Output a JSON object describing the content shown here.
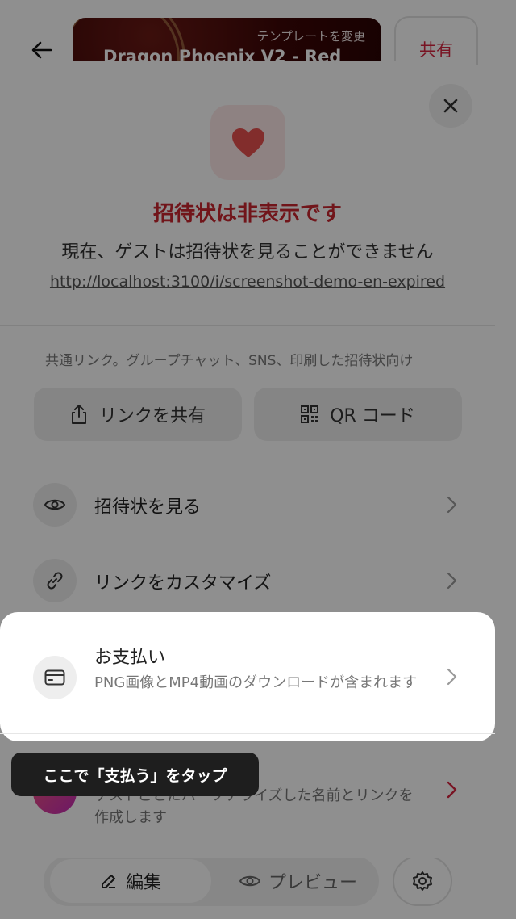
{
  "header": {
    "template_change_label": "テンプレートを変更",
    "template_name": "Dragon Phoenix V2 - Red",
    "share_label": "共有"
  },
  "modal": {
    "status_title": "招待状は非表示です",
    "status_subtitle": "現在、ゲストは招待状を見ることができません",
    "invitation_url": "http://localhost:3100/i/screenshot-demo-en-expired",
    "share_caption": "共通リンク。グループチャット、SNS、印刷した招待状向け",
    "share_link_label": "リンクを共有",
    "qr_code_label": "QR コード",
    "items": [
      {
        "title": "招待状を見る",
        "icon": "eye-icon"
      },
      {
        "title": "リンクをカスタマイズ",
        "icon": "link-icon"
      },
      {
        "title": "お支払い",
        "description": "PNG画像とMP4動画のダウンロードが含まれます",
        "icon": "credit-card-icon"
      },
      {
        "description": "ゲストごとにパーソナライズした名前とリンクを作成します",
        "icon": "personalize-icon"
      }
    ]
  },
  "tooltip": {
    "text": "ここで「支払う」をタップ"
  },
  "bottom_bar": {
    "edit_label": "編集",
    "preview_label": "プレビュー"
  },
  "colors": {
    "accent_red": "#c9262f",
    "share_red": "#d6243f",
    "tooltip_bg": "#1e1e1e"
  }
}
